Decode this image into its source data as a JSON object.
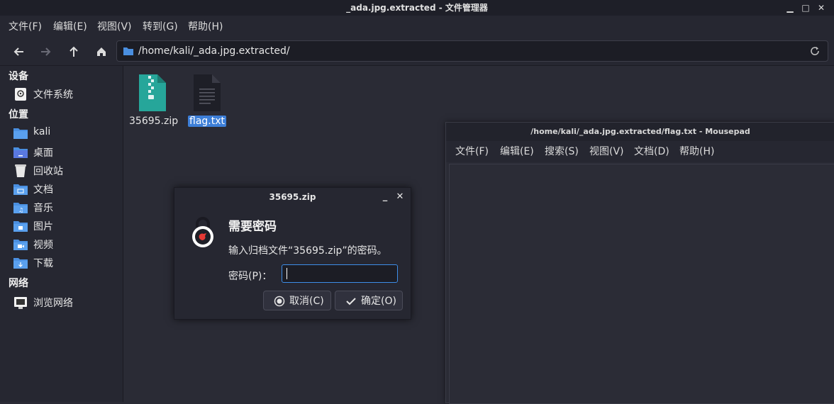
{
  "window": {
    "title": "_ada.jpg.extracted - 文件管理器",
    "controls": [
      "▁",
      "□",
      "✕"
    ]
  },
  "menubar": [
    "文件(F)",
    "编辑(E)",
    "视图(V)",
    "转到(G)",
    "帮助(H)"
  ],
  "toolbar": {
    "path": "/home/kali/_ada.jpg.extracted/"
  },
  "sidebar": {
    "sections": [
      {
        "heading": "设备",
        "items": [
          {
            "label": "文件系统",
            "icon": "drive-icon"
          }
        ]
      },
      {
        "heading": "位置",
        "items": [
          {
            "label": "kali",
            "icon": "home-folder-icon"
          },
          {
            "label": "桌面",
            "icon": "desktop-folder-icon"
          },
          {
            "label": "回收站",
            "icon": "trash-icon"
          },
          {
            "label": "文档",
            "icon": "documents-folder-icon"
          },
          {
            "label": "音乐",
            "icon": "music-folder-icon"
          },
          {
            "label": "图片",
            "icon": "pictures-folder-icon"
          },
          {
            "label": "视频",
            "icon": "videos-folder-icon"
          },
          {
            "label": "下载",
            "icon": "downloads-folder-icon"
          }
        ]
      },
      {
        "heading": "网络",
        "items": [
          {
            "label": "浏览网络",
            "icon": "network-icon"
          }
        ]
      }
    ]
  },
  "files": [
    {
      "name": "35695.zip",
      "icon": "zip-archive-icon",
      "selected": false
    },
    {
      "name": "flag.txt",
      "icon": "text-file-icon",
      "selected": true
    }
  ],
  "mousepad": {
    "title": "/home/kali/_ada.jpg.extracted/flag.txt - Mousepad",
    "menubar": [
      "文件(F)",
      "编辑(E)",
      "搜索(S)",
      "视图(V)",
      "文档(D)",
      "帮助(H)"
    ]
  },
  "dialog": {
    "title": "35695.zip",
    "heading": "需要密码",
    "message": "输入归档文件“35695.zip”的密码。",
    "password_label": "密码(P)：",
    "password_value": "",
    "cancel_label": "取消(C)",
    "ok_label": "确定(O)",
    "controls": [
      "_",
      "✕"
    ]
  },
  "colors": {
    "accent": "#3d8ee8",
    "folder": "#4a8fe0",
    "zip": "#26a69a",
    "selection": "#3d7fd8"
  }
}
